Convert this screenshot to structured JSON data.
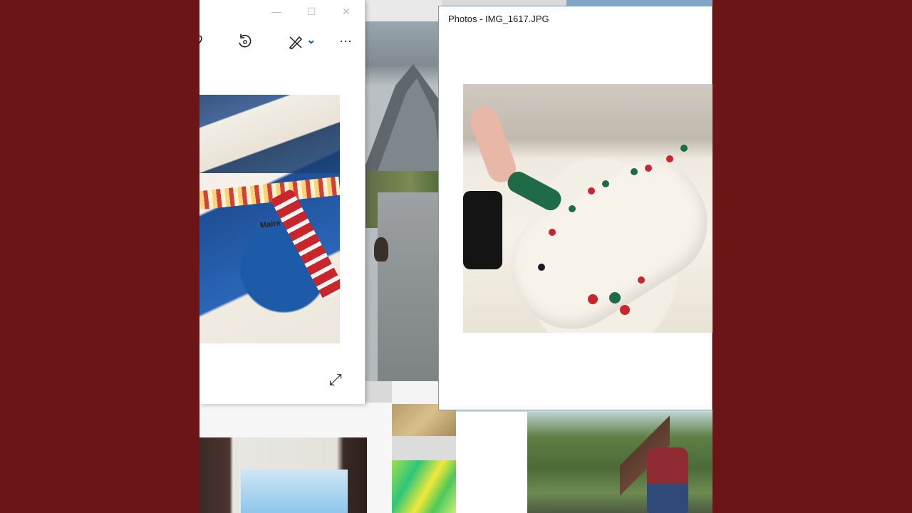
{
  "desktop": {
    "background_color": "#6b1516"
  },
  "left_window": {
    "caption_buttons": {
      "minimize": "—",
      "maximize": "☐",
      "close": "✕"
    },
    "toolbar": {
      "favorite_icon": "heart-icon",
      "rotate_icon": "rotate-icon",
      "edit_icon": "edit-draw-icon",
      "edit_dropdown_glyph": "⌄",
      "more_glyph": "···"
    },
    "photo_caption": "Maire",
    "fullscreen_glyph": "⤢"
  },
  "right_window": {
    "title": "Photos - IMG_1617.JPG",
    "accent_color": "#6f9fcf"
  }
}
